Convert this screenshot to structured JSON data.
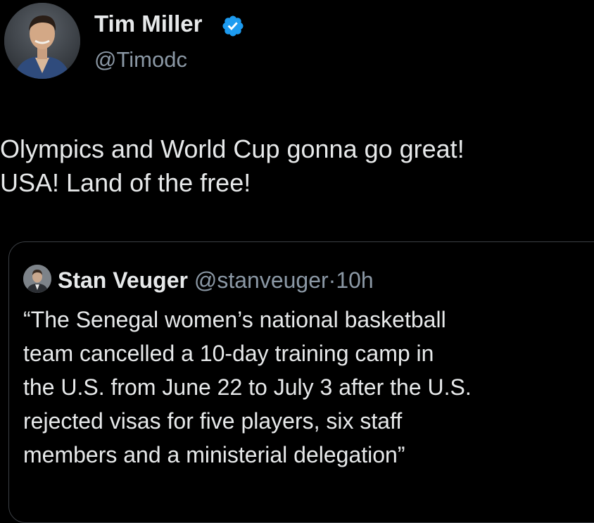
{
  "author": {
    "name": "Tim Miller",
    "handle": "@Timodc",
    "verified": true,
    "avatar_icon": "profile-photo"
  },
  "tweet": {
    "lines": [
      "Olympics and World Cup gonna go great!",
      "USA! Land of the free!"
    ]
  },
  "quote": {
    "author_name": "Stan Veuger",
    "handle": "@stanveuger",
    "separator": "·",
    "time": "10h",
    "lines": [
      "“The Senegal women’s national basketball",
      "team cancelled a 10-day training camp in",
      "the U.S. from June 22 to July 3 after the U.S.",
      "rejected visas for five players, six staff",
      "members and a ministerial delegation”"
    ]
  },
  "colors": {
    "background": "#000000",
    "text_primary": "#e7e9ea",
    "text_secondary": "#8b98a5",
    "verified_badge": "#1d9bf0",
    "border": "#3b3f44"
  }
}
